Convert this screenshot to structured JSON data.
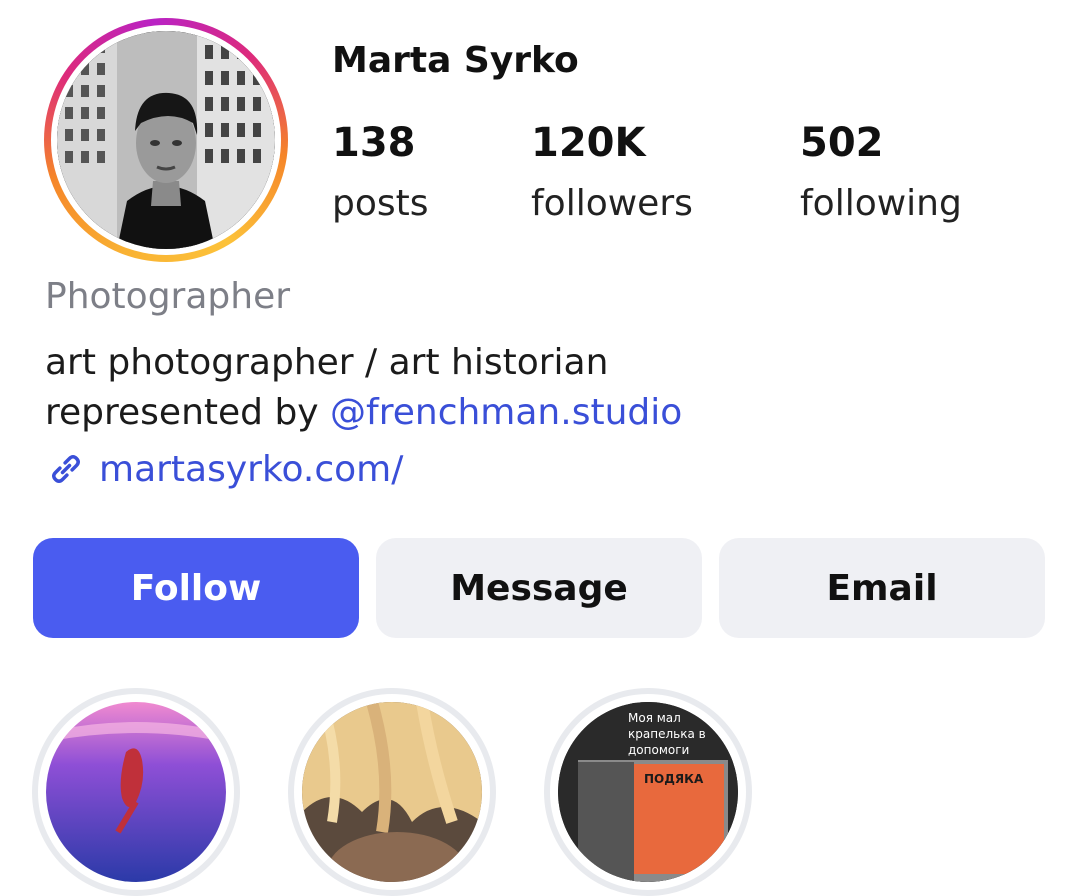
{
  "profile": {
    "name": "Marta Syrko",
    "stats": [
      {
        "value": "138",
        "label": "posts"
      },
      {
        "value": "120K",
        "label": "followers"
      },
      {
        "value": "502",
        "label": "following"
      }
    ],
    "category": "Photographer",
    "bio_line1": "art photographer / art historian",
    "bio_line2_prefix": "represented by ",
    "bio_mention": "@frenchman.studio",
    "website": "martasyrko.com/"
  },
  "actions": {
    "follow": "Follow",
    "message": "Message",
    "email": "Email"
  },
  "highlights": {
    "third_text_line1": "Моя мал",
    "third_text_line2": "крапелька в",
    "third_text_line3": "допомоги",
    "third_card_title": "ПОДЯКА"
  },
  "colors": {
    "accent": "#4a5cf0",
    "link": "#3a4fd8",
    "secondary_button": "#eff0f4",
    "muted_text": "#7d7f87"
  }
}
